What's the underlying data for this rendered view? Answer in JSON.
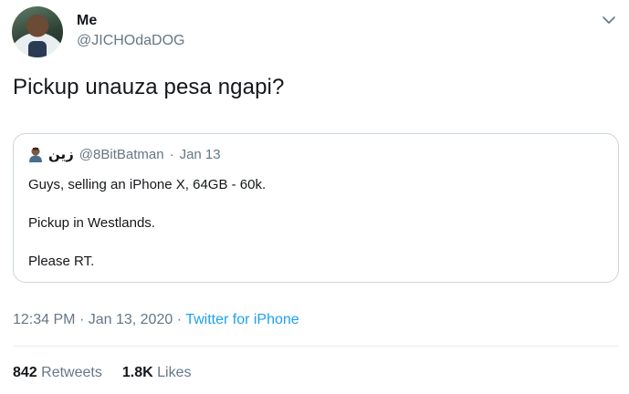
{
  "author": {
    "display_name": "Me",
    "handle": "@JICHOdaDOG"
  },
  "tweet": {
    "text": "Pickup unauza pesa ngapi?"
  },
  "quoted_tweet": {
    "display_name": "زين",
    "handle": "@8BitBatman",
    "separator": "·",
    "date": "Jan 13",
    "lines": [
      "Guys, selling an iPhone X, 64GB - 60k.",
      "Pickup in Westlands.",
      "Please RT."
    ]
  },
  "meta": {
    "time": "12:34 PM",
    "separator": "·",
    "date": "Jan 13, 2020",
    "source": "Twitter for iPhone"
  },
  "stats": {
    "retweets_count": "842",
    "retweets_label": "Retweets",
    "likes_count": "1.8K",
    "likes_label": "Likes"
  },
  "icons": {
    "menu": "chevron-down-icon",
    "quoted_avatar": "avatar-icon"
  },
  "colors": {
    "link": "#1da1f2",
    "secondary_text": "#657786",
    "primary_text": "#14171a",
    "border": "#ccd6dd"
  }
}
